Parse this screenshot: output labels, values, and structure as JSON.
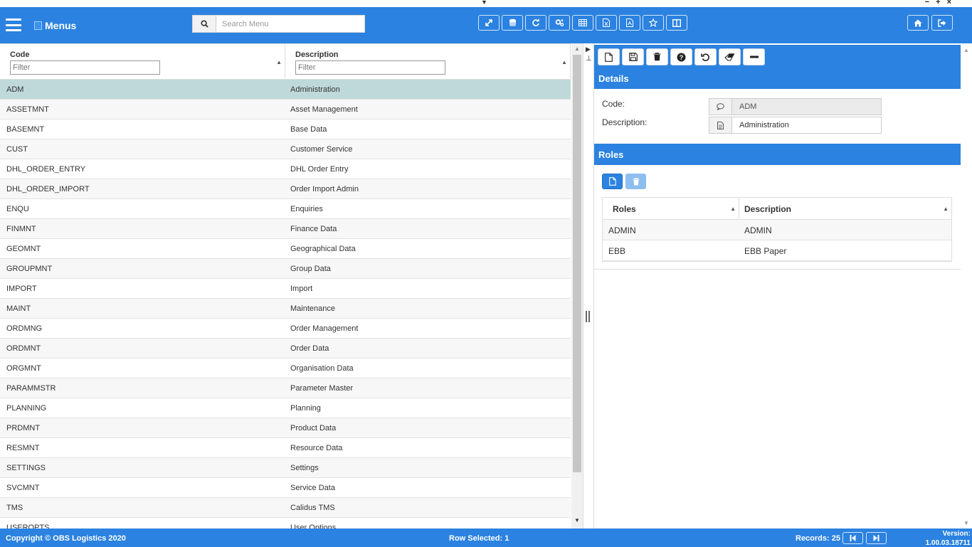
{
  "window": {
    "collapse_caret": "▼",
    "controls": "− + ×"
  },
  "header": {
    "title": "Menus",
    "search_placeholder": "Search Menu",
    "toolbar_icons": [
      "expand-icon",
      "database-icon",
      "refresh-icon",
      "cogs-icon",
      "table-icon",
      "excel-export-icon",
      "pdf-export-icon",
      "favorite-star-icon",
      "columns-icon"
    ],
    "right_icons": [
      "home-icon",
      "logout-icon"
    ]
  },
  "grid": {
    "columns": [
      {
        "title": "Code",
        "filter_placeholder": "Filter"
      },
      {
        "title": "Description",
        "filter_placeholder": "Filter"
      }
    ],
    "rows": [
      {
        "code": "ADM",
        "description": "Administration",
        "selected": true
      },
      {
        "code": "ASSETMNT",
        "description": "Asset Management"
      },
      {
        "code": "BASEMNT",
        "description": "Base Data"
      },
      {
        "code": "CUST",
        "description": "Customer Service"
      },
      {
        "code": "DHL_ORDER_ENTRY",
        "description": "DHL Order Entry"
      },
      {
        "code": "DHL_ORDER_IMPORT",
        "description": "Order Import Admin"
      },
      {
        "code": "ENQU",
        "description": "Enquiries"
      },
      {
        "code": "FINMNT",
        "description": "Finance Data"
      },
      {
        "code": "GEOMNT",
        "description": "Geographical Data"
      },
      {
        "code": "GROUPMNT",
        "description": "Group Data"
      },
      {
        "code": "IMPORT",
        "description": "Import"
      },
      {
        "code": "MAINT",
        "description": "Maintenance"
      },
      {
        "code": "ORDMNG",
        "description": "Order Management"
      },
      {
        "code": "ORDMNT",
        "description": "Order Data"
      },
      {
        "code": "ORGMNT",
        "description": "Organisation Data"
      },
      {
        "code": "PARAMMSTR",
        "description": "Parameter Master"
      },
      {
        "code": "PLANNING",
        "description": "Planning"
      },
      {
        "code": "PRDMNT",
        "description": "Product Data"
      },
      {
        "code": "RESMNT",
        "description": "Resource Data"
      },
      {
        "code": "SETTINGS",
        "description": "Settings"
      },
      {
        "code": "SVCMNT",
        "description": "Service Data"
      },
      {
        "code": "TMS",
        "description": "Calidus TMS"
      },
      {
        "code": "USEROPTS",
        "description": "User Options"
      }
    ]
  },
  "details": {
    "title": "Details",
    "code_label": "Code:",
    "code_value": "ADM",
    "description_label": "Description:",
    "description_value": "Administration",
    "toolbar_icons": [
      "new-icon",
      "save-icon",
      "delete-icon",
      "help-icon",
      "undo-icon",
      "eraser-icon",
      "minus-icon"
    ]
  },
  "roles": {
    "title": "Roles",
    "columns": [
      "Roles",
      "Description"
    ],
    "rows": [
      {
        "role": "ADMIN",
        "description": "ADMIN"
      },
      {
        "role": "EBB",
        "description": "EBB Paper"
      }
    ]
  },
  "footer": {
    "copyright": "Copyright © OBS Logistics 2020",
    "row_selected": "Row Selected: 1",
    "records": "Records: 25",
    "version_label": "Version:",
    "version_value": "1.00.03.18711"
  },
  "colors": {
    "accent": "#2b82e0",
    "selected_row": "#bfd9da"
  }
}
